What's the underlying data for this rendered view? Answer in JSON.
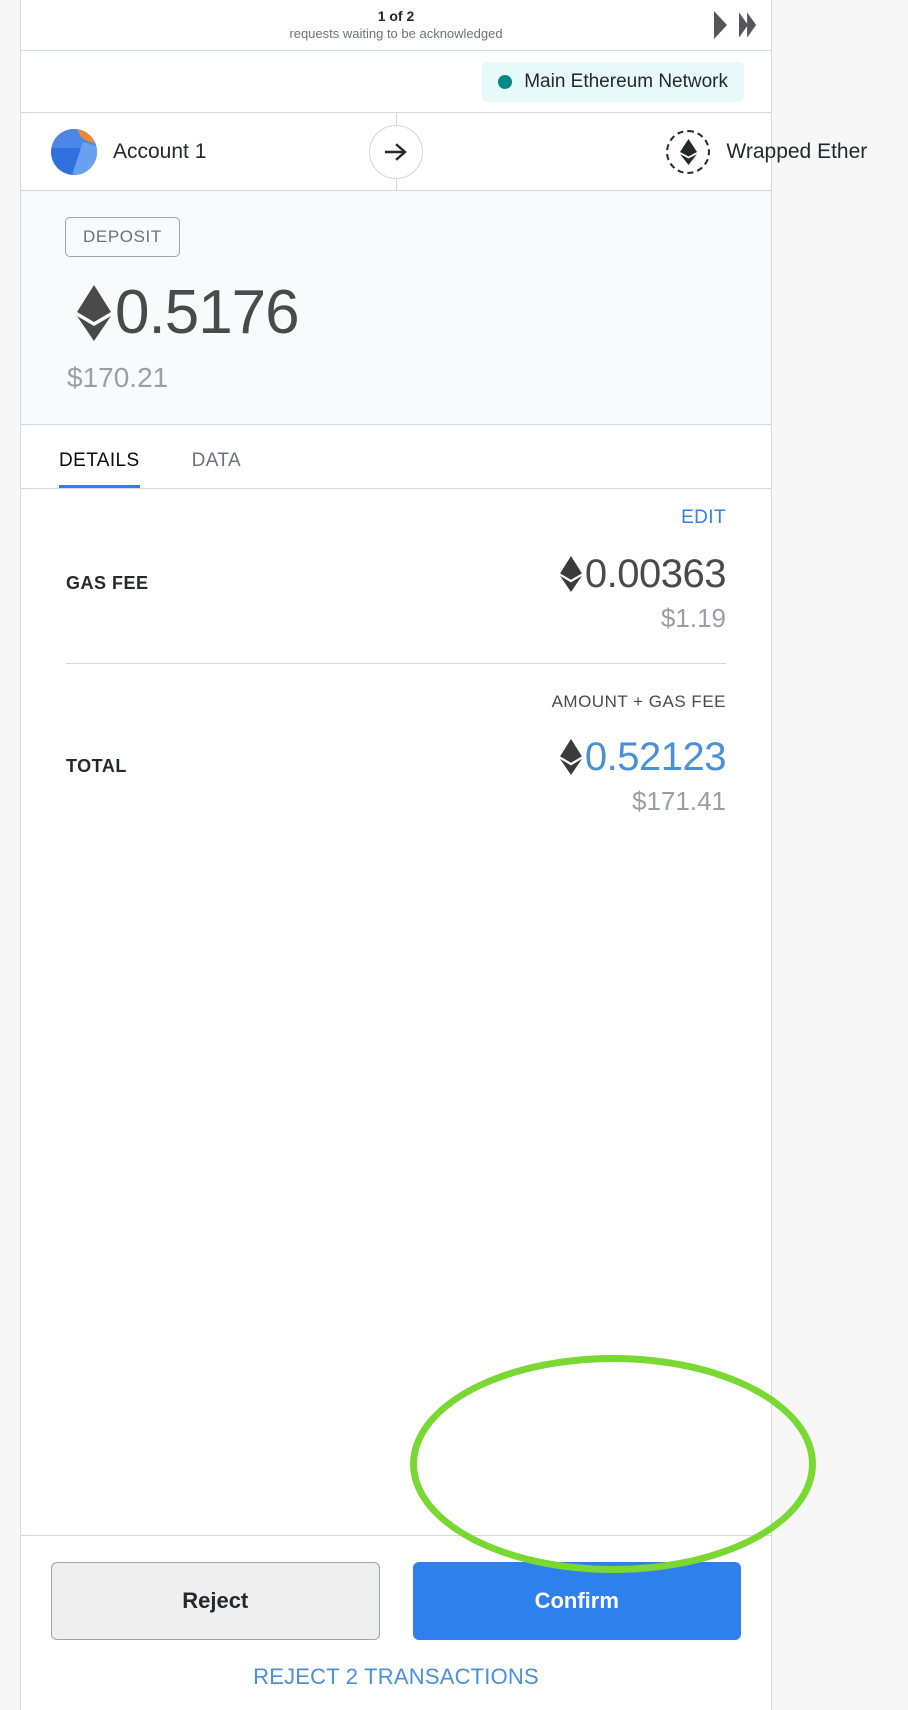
{
  "pending": {
    "count_label": "1 of 2",
    "subtitle": "requests waiting to be acknowledged",
    "next_icon": "caret-right-icon",
    "last_icon": "double-caret-right-icon"
  },
  "network": {
    "name": "Main Ethereum Network",
    "status_color": "#038789",
    "pill_background": "#e7f9f8",
    "dot_icon": "network-status-dot-icon"
  },
  "parties": {
    "from": {
      "name": "Account 1",
      "avatar_icon": "account-identicon-icon"
    },
    "direction_icon": "arrow-right-icon",
    "to": {
      "name": "Wrapped Ether",
      "token_icon": "ethereum-diamond-icon"
    }
  },
  "amount": {
    "action_label": "DEPOSIT",
    "currency_icon": "ethereum-diamond-icon",
    "value": "0.5176",
    "fiat": "$170.21"
  },
  "tabs": [
    {
      "label": "DETAILS",
      "active": true
    },
    {
      "label": "DATA",
      "active": false
    }
  ],
  "details": {
    "edit_label": "EDIT",
    "gas_fee": {
      "label": "GAS FEE",
      "currency_icon": "ethereum-diamond-icon",
      "value": "0.00363",
      "fiat": "$1.19"
    },
    "subtotal_label": "AMOUNT + GAS FEE",
    "total": {
      "label": "TOTAL",
      "currency_icon": "ethereum-diamond-icon",
      "value": "0.52123",
      "fiat": "$171.41",
      "value_color": "#4a90d9"
    }
  },
  "footer": {
    "reject_label": "Reject",
    "confirm_label": "Confirm",
    "reject_all_label": "REJECT 2 TRANSACTIONS"
  },
  "annotation": {
    "target": "confirm-button",
    "color": "#79d832",
    "shape": "ellipse"
  }
}
